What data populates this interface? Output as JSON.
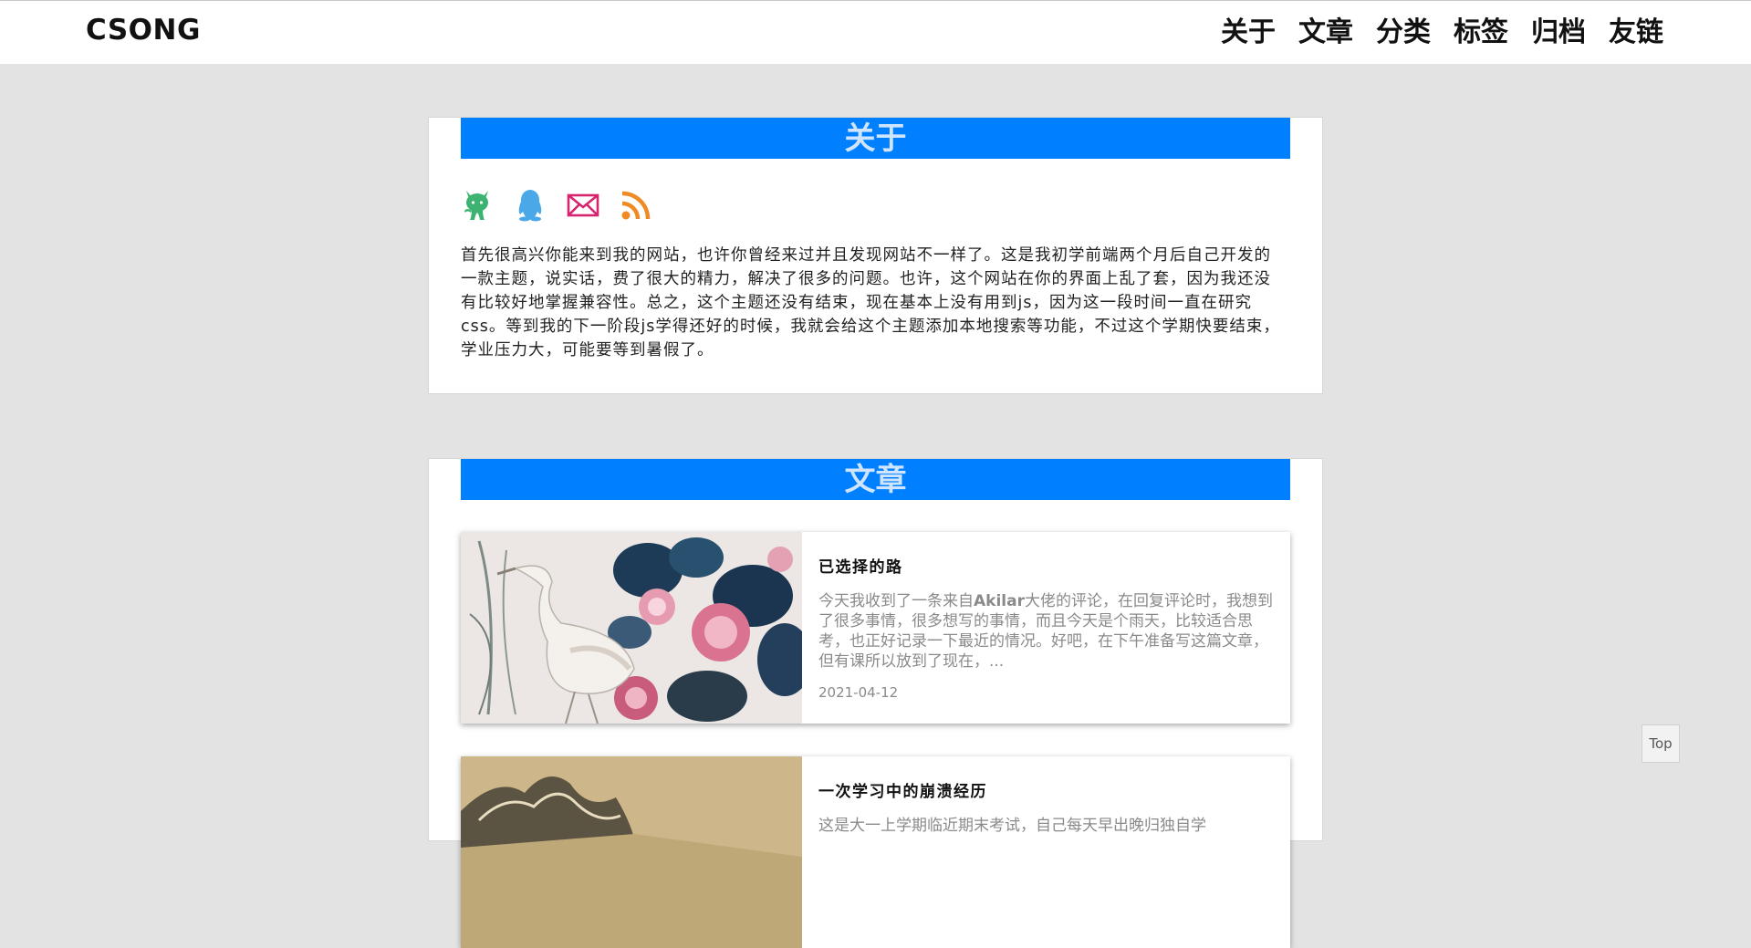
{
  "header": {
    "brand": "CSONG",
    "nav": [
      "关于",
      "文章",
      "分类",
      "标签",
      "归档",
      "友链"
    ]
  },
  "about": {
    "title": "关于",
    "icons": [
      "github-icon",
      "qq-icon",
      "mail-icon",
      "rss-icon"
    ],
    "text": "首先很高兴你能来到我的网站，也许你曾经来过并且发现网站不一样了。这是我初学前端两个月后自己开发的一款主题，说实话，费了很大的精力，解决了很多的问题。也许，这个网站在你的界面上乱了套，因为我还没有比较好地掌握兼容性。总之，这个主题还没有结束，现在基本上没有用到js，因为这一段时间一直在研究css。等到我的下一阶段js学得还好的时候，我就会给这个主题添加本地搜索等功能，不过这个学期快要结束，学业压力大，可能要等到暑假了。"
  },
  "posts": {
    "title": "文章",
    "items": [
      {
        "title": "已选择的路",
        "summary_parts": [
          "今天我收到了一条来自",
          "Akilar",
          "大佬的评论，在回复评论时，我想到了很多事情，很多想写的事情，而且今天是个雨天，比较适合思考，也正好记录一下最近的情况。好吧，在下午准备写这篇文章，但有课所以放到了现在，..."
        ],
        "date": "2021-04-12"
      },
      {
        "title": "一次学习中的崩溃经历",
        "summary": "这是大一上学期临近期末考试，自己每天早出晚归独自学"
      }
    ]
  },
  "top_button": "Top",
  "colors": {
    "accent": "#0080ff",
    "header_text": "#cfe5ff",
    "github": "#3cb371",
    "qq": "#4aa8e8",
    "mail": "#d6246e",
    "rss": "#f08a24"
  }
}
